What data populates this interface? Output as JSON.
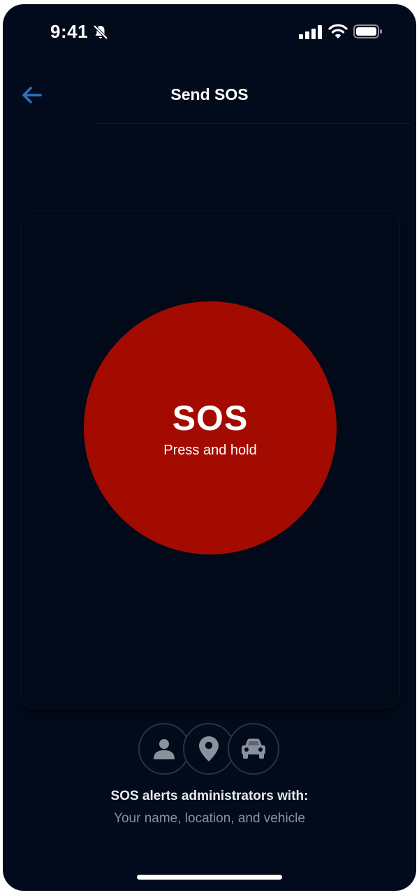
{
  "status_bar": {
    "time": "9:41",
    "icons": [
      "bell-slash-icon",
      "signal-icon",
      "wifi-icon",
      "battery-icon"
    ]
  },
  "nav": {
    "title": "Send SOS",
    "back_icon": "arrow-left-icon"
  },
  "sos": {
    "label": "SOS",
    "sublabel": "Press and hold"
  },
  "info": {
    "icons": [
      "person-icon",
      "location-pin-icon",
      "car-icon"
    ],
    "title": "SOS alerts administrators with:",
    "subtitle": "Your name, location, and vehicle"
  },
  "colors": {
    "background": "#020b1c",
    "sos_red": "#a30b00",
    "accent_blue": "#2f6fc0",
    "icon_gray": "#8a919c"
  }
}
